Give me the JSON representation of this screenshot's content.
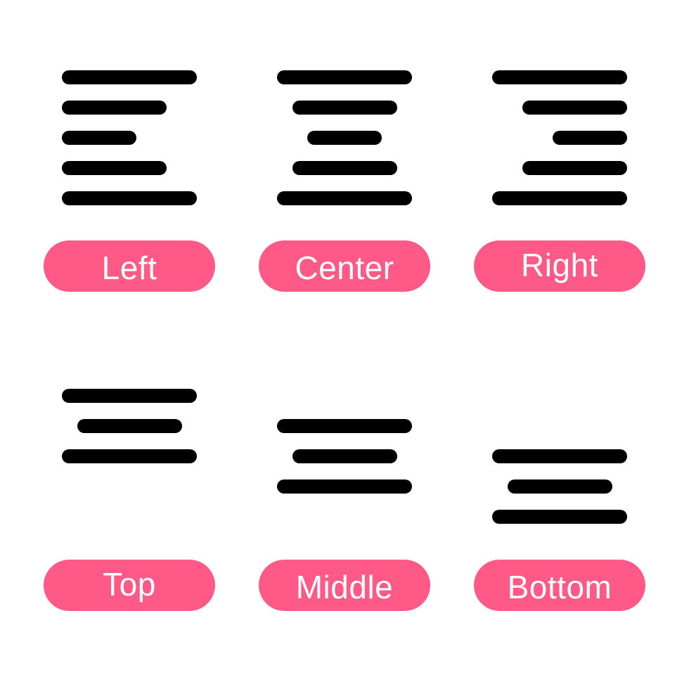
{
  "accent_color": "#FF5A87",
  "bar_color": "#000000",
  "options": [
    {
      "id": "left",
      "label": "Left",
      "icon": "align-left-icon",
      "alignment": "horizontal-left",
      "bars": [
        1.0,
        0.775,
        0.55,
        0.775,
        1.0
      ]
    },
    {
      "id": "center",
      "label": "Center",
      "icon": "align-center-icon",
      "alignment": "horizontal-center",
      "bars": [
        1.0,
        0.775,
        0.55,
        0.775,
        1.0
      ]
    },
    {
      "id": "right",
      "label": "Right",
      "icon": "align-right-icon",
      "alignment": "horizontal-right",
      "bars": [
        1.0,
        0.775,
        0.55,
        0.775,
        1.0
      ]
    },
    {
      "id": "top",
      "label": "Top",
      "icon": "align-top-icon",
      "alignment": "vertical-top",
      "bars": [
        1.0,
        0.775,
        1.0
      ]
    },
    {
      "id": "middle",
      "label": "Middle",
      "icon": "align-middle-icon",
      "alignment": "vertical-middle",
      "bars": [
        1.0,
        0.775,
        1.0
      ]
    },
    {
      "id": "bottom",
      "label": "Bottom",
      "icon": "align-bottom-icon",
      "alignment": "vertical-bottom",
      "bars": [
        1.0,
        0.775,
        1.0
      ]
    }
  ]
}
